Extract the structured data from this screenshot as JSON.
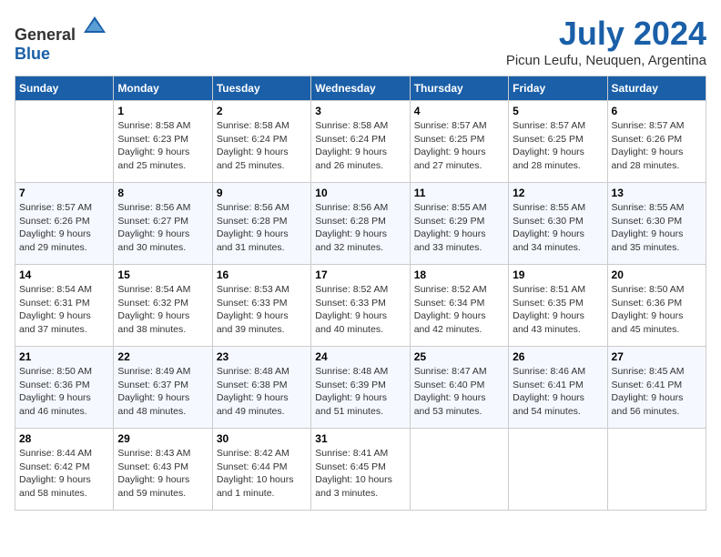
{
  "header": {
    "logo_general": "General",
    "logo_blue": "Blue",
    "title": "July 2024",
    "location": "Picun Leufu, Neuquen, Argentina"
  },
  "columns": [
    "Sunday",
    "Monday",
    "Tuesday",
    "Wednesday",
    "Thursday",
    "Friday",
    "Saturday"
  ],
  "weeks": [
    [
      {
        "day": "",
        "info": ""
      },
      {
        "day": "1",
        "info": "Sunrise: 8:58 AM\nSunset: 6:23 PM\nDaylight: 9 hours\nand 25 minutes."
      },
      {
        "day": "2",
        "info": "Sunrise: 8:58 AM\nSunset: 6:24 PM\nDaylight: 9 hours\nand 25 minutes."
      },
      {
        "day": "3",
        "info": "Sunrise: 8:58 AM\nSunset: 6:24 PM\nDaylight: 9 hours\nand 26 minutes."
      },
      {
        "day": "4",
        "info": "Sunrise: 8:57 AM\nSunset: 6:25 PM\nDaylight: 9 hours\nand 27 minutes."
      },
      {
        "day": "5",
        "info": "Sunrise: 8:57 AM\nSunset: 6:25 PM\nDaylight: 9 hours\nand 28 minutes."
      },
      {
        "day": "6",
        "info": "Sunrise: 8:57 AM\nSunset: 6:26 PM\nDaylight: 9 hours\nand 28 minutes."
      }
    ],
    [
      {
        "day": "7",
        "info": "Sunrise: 8:57 AM\nSunset: 6:26 PM\nDaylight: 9 hours\nand 29 minutes."
      },
      {
        "day": "8",
        "info": "Sunrise: 8:56 AM\nSunset: 6:27 PM\nDaylight: 9 hours\nand 30 minutes."
      },
      {
        "day": "9",
        "info": "Sunrise: 8:56 AM\nSunset: 6:28 PM\nDaylight: 9 hours\nand 31 minutes."
      },
      {
        "day": "10",
        "info": "Sunrise: 8:56 AM\nSunset: 6:28 PM\nDaylight: 9 hours\nand 32 minutes."
      },
      {
        "day": "11",
        "info": "Sunrise: 8:55 AM\nSunset: 6:29 PM\nDaylight: 9 hours\nand 33 minutes."
      },
      {
        "day": "12",
        "info": "Sunrise: 8:55 AM\nSunset: 6:30 PM\nDaylight: 9 hours\nand 34 minutes."
      },
      {
        "day": "13",
        "info": "Sunrise: 8:55 AM\nSunset: 6:30 PM\nDaylight: 9 hours\nand 35 minutes."
      }
    ],
    [
      {
        "day": "14",
        "info": "Sunrise: 8:54 AM\nSunset: 6:31 PM\nDaylight: 9 hours\nand 37 minutes."
      },
      {
        "day": "15",
        "info": "Sunrise: 8:54 AM\nSunset: 6:32 PM\nDaylight: 9 hours\nand 38 minutes."
      },
      {
        "day": "16",
        "info": "Sunrise: 8:53 AM\nSunset: 6:33 PM\nDaylight: 9 hours\nand 39 minutes."
      },
      {
        "day": "17",
        "info": "Sunrise: 8:52 AM\nSunset: 6:33 PM\nDaylight: 9 hours\nand 40 minutes."
      },
      {
        "day": "18",
        "info": "Sunrise: 8:52 AM\nSunset: 6:34 PM\nDaylight: 9 hours\nand 42 minutes."
      },
      {
        "day": "19",
        "info": "Sunrise: 8:51 AM\nSunset: 6:35 PM\nDaylight: 9 hours\nand 43 minutes."
      },
      {
        "day": "20",
        "info": "Sunrise: 8:50 AM\nSunset: 6:36 PM\nDaylight: 9 hours\nand 45 minutes."
      }
    ],
    [
      {
        "day": "21",
        "info": "Sunrise: 8:50 AM\nSunset: 6:36 PM\nDaylight: 9 hours\nand 46 minutes."
      },
      {
        "day": "22",
        "info": "Sunrise: 8:49 AM\nSunset: 6:37 PM\nDaylight: 9 hours\nand 48 minutes."
      },
      {
        "day": "23",
        "info": "Sunrise: 8:48 AM\nSunset: 6:38 PM\nDaylight: 9 hours\nand 49 minutes."
      },
      {
        "day": "24",
        "info": "Sunrise: 8:48 AM\nSunset: 6:39 PM\nDaylight: 9 hours\nand 51 minutes."
      },
      {
        "day": "25",
        "info": "Sunrise: 8:47 AM\nSunset: 6:40 PM\nDaylight: 9 hours\nand 53 minutes."
      },
      {
        "day": "26",
        "info": "Sunrise: 8:46 AM\nSunset: 6:41 PM\nDaylight: 9 hours\nand 54 minutes."
      },
      {
        "day": "27",
        "info": "Sunrise: 8:45 AM\nSunset: 6:41 PM\nDaylight: 9 hours\nand 56 minutes."
      }
    ],
    [
      {
        "day": "28",
        "info": "Sunrise: 8:44 AM\nSunset: 6:42 PM\nDaylight: 9 hours\nand 58 minutes."
      },
      {
        "day": "29",
        "info": "Sunrise: 8:43 AM\nSunset: 6:43 PM\nDaylight: 9 hours\nand 59 minutes."
      },
      {
        "day": "30",
        "info": "Sunrise: 8:42 AM\nSunset: 6:44 PM\nDaylight: 10 hours\nand 1 minute."
      },
      {
        "day": "31",
        "info": "Sunrise: 8:41 AM\nSunset: 6:45 PM\nDaylight: 10 hours\nand 3 minutes."
      },
      {
        "day": "",
        "info": ""
      },
      {
        "day": "",
        "info": ""
      },
      {
        "day": "",
        "info": ""
      }
    ]
  ]
}
